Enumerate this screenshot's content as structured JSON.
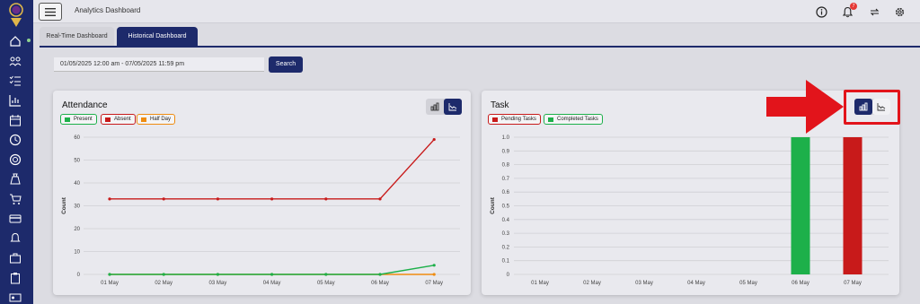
{
  "header": {
    "title": "Analytics Dashboard",
    "notification_count": "7"
  },
  "tabs": [
    {
      "label": "Real-Time Dashboard"
    },
    {
      "label": "Historical Dashboard"
    }
  ],
  "filter": {
    "date_range": "01/05/2025 12:00 am - 07/05/2025 11:59 pm",
    "search_label": "Search"
  },
  "colors": {
    "brand": "#1d2a6b",
    "present": "#1db04a",
    "absent": "#c81a1a",
    "half_day": "#ef8c10",
    "pending": "#c81a1a",
    "completed": "#1db04a",
    "highlight": "#e2141b"
  },
  "sidebar_icons": [
    "home-icon",
    "users-icon",
    "checklist-icon",
    "chart-icon",
    "calendar-icon",
    "clock-icon",
    "target-icon",
    "money-bag-icon",
    "cart-icon",
    "card-icon",
    "bell-icon",
    "briefcase-icon",
    "clipboard-icon",
    "id-card-icon"
  ],
  "attendance": {
    "title": "Attendance",
    "legend": [
      "Present",
      "Absent",
      "Half Day"
    ]
  },
  "task": {
    "title": "Task",
    "legend": [
      "Pending Tasks",
      "Completed Tasks"
    ]
  },
  "chart_data": [
    {
      "type": "line",
      "title": "Attendance",
      "ylabel": "Count",
      "x": [
        "01 May",
        "02 May",
        "03 May",
        "04 May",
        "05 May",
        "06 May",
        "07 May"
      ],
      "yticks": [
        0,
        10,
        20,
        30,
        40,
        50,
        60
      ],
      "ylim": [
        0,
        60
      ],
      "series": [
        {
          "name": "Present",
          "values": [
            0,
            0,
            0,
            0,
            0,
            0,
            4
          ]
        },
        {
          "name": "Absent",
          "values": [
            33,
            33,
            33,
            33,
            33,
            33,
            59
          ]
        },
        {
          "name": "Half Day",
          "values": [
            0,
            0,
            0,
            0,
            0,
            0,
            0
          ]
        }
      ],
      "grid": true,
      "legend_position": "top-left"
    },
    {
      "type": "bar",
      "title": "Task",
      "ylabel": "Count",
      "categories": [
        "01 May",
        "02 May",
        "03 May",
        "04 May",
        "05 May",
        "06 May",
        "07 May"
      ],
      "yticks": [
        0,
        0.1,
        0.2,
        0.3,
        0.4,
        0.5,
        0.6,
        0.7,
        0.8,
        0.9,
        1.0
      ],
      "ylim": [
        0,
        1.0
      ],
      "series": [
        {
          "name": "Pending Tasks",
          "values": [
            0,
            0,
            0,
            0,
            0,
            0,
            1
          ]
        },
        {
          "name": "Completed Tasks",
          "values": [
            0,
            0,
            0,
            0,
            0,
            1,
            0
          ]
        }
      ],
      "grid": true,
      "legend_position": "top-left"
    }
  ]
}
